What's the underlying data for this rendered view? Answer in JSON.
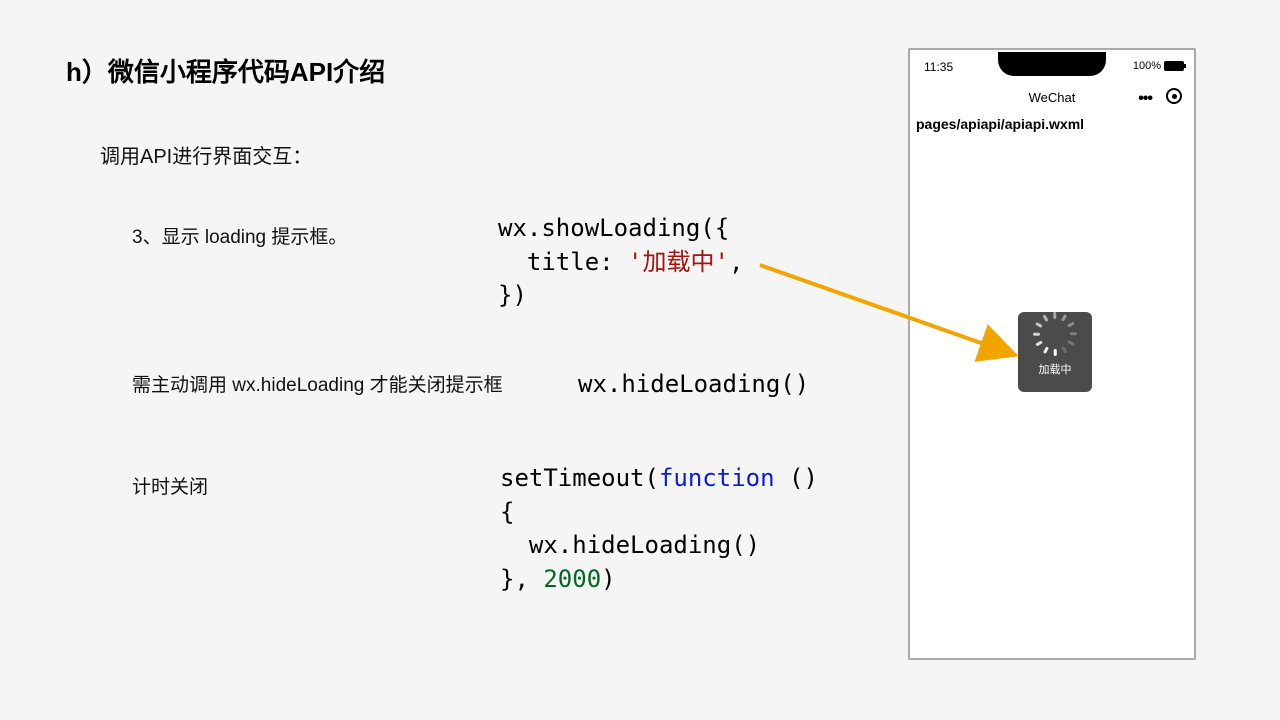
{
  "heading": "h）微信小程序代码API介绍",
  "subheading": "调用API进行界面交互：",
  "rows": {
    "r1": "3、显示 loading 提示框。",
    "r2": "需主动调用 wx.hideLoading 才能关闭提示框",
    "r3": "计时关闭"
  },
  "code1": {
    "l1": "wx.showLoading({",
    "l2a": "  title: ",
    "l2b": "'加载中'",
    "l2c": ",",
    "l3": "})"
  },
  "code2": "wx.hideLoading()",
  "code3": {
    "l1a": "setTimeout(",
    "l1b": "function",
    "l1c": " ()",
    "l2": "{",
    "l3": "  wx.hideLoading()",
    "l4a": "}, ",
    "l4b": "2000",
    "l4c": ")"
  },
  "phone": {
    "time": "11:35",
    "battery": "100%",
    "navTitle": "WeChat",
    "path": "pages/apiapi/apiapi.wxml",
    "toast": "加载中"
  }
}
